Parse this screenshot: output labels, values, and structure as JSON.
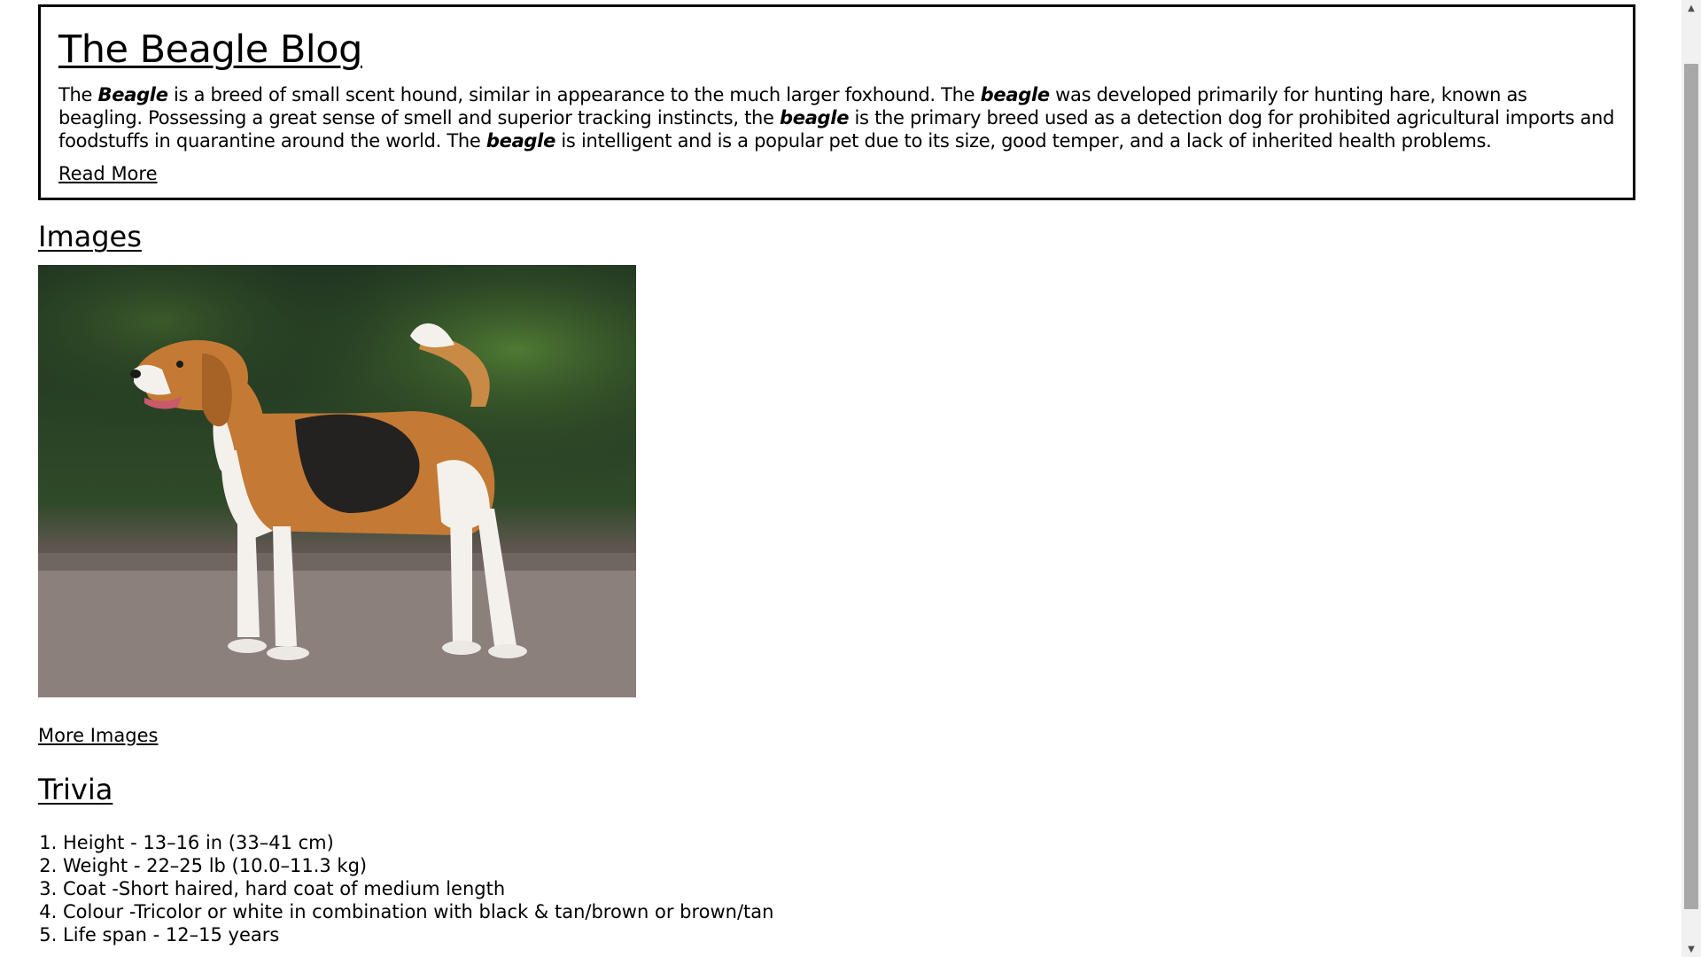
{
  "intro": {
    "title": "The Beagle Blog",
    "paragraph": [
      {
        "t": "The ",
        "em": false
      },
      {
        "t": "Beagle",
        "em": true
      },
      {
        "t": " is a breed of small scent hound, similar in appearance to the much larger foxhound. The ",
        "em": false
      },
      {
        "t": "beagle",
        "em": true
      },
      {
        "t": " was developed primarily for hunting hare, known as beagling. Possessing a great sense of smell and superior tracking instincts, the ",
        "em": false
      },
      {
        "t": "beagle",
        "em": true
      },
      {
        "t": " is the primary breed used as a detection dog for prohibited agricultural imports and foodstuffs in quarantine around the world. The ",
        "em": false
      },
      {
        "t": "beagle",
        "em": true
      },
      {
        "t": " is intelligent and is a popular pet due to its size, good temper, and a lack of inherited health problems.",
        "em": false
      }
    ],
    "read_more": "Read More"
  },
  "images": {
    "heading": "Images",
    "photo_icon": "beagle-photo",
    "more_link": "More Images"
  },
  "trivia": {
    "heading": "Trivia",
    "items": [
      "Height - 13–16 in (33–41 cm)",
      "Weight - 22–25 lb (10.0–11.3 kg)",
      "Coat -Short haired, hard coat of medium length",
      "Colour -Tricolor or white in combination with black & tan/brown or brown/tan",
      "Life span - 12–15 years"
    ]
  },
  "scrollbar": {
    "up_icon": "triangle-up",
    "down_icon": "triangle-down",
    "up_glyph": "▲",
    "down_glyph": "▼"
  }
}
